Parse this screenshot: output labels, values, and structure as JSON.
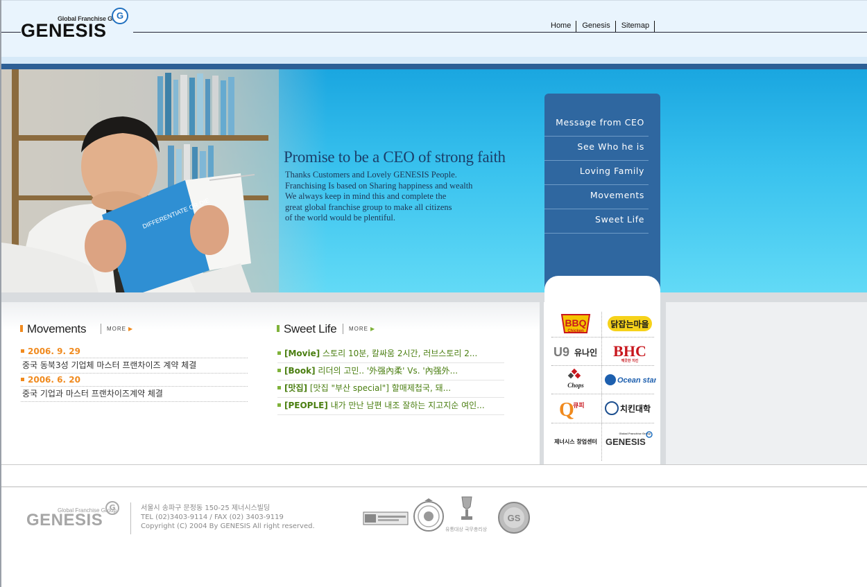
{
  "header": {
    "logo_tagline": "Global Franchise Group",
    "logo_wordmark": "GENESIS",
    "nav": [
      "Home",
      "Genesis",
      "Sitemap"
    ]
  },
  "hero": {
    "title": "Promise to be a CEO of strong faith",
    "lines": [
      "Thanks Customers and Lovely GENESIS People.",
      "Franchising Is based on Sharing happiness and wealth",
      "We always keep in mind this and complete the",
      "great global franchise group to make all citizens",
      "of the world would be plentiful."
    ],
    "book_cover_text": "DIFFERENTIATE OR DIE"
  },
  "sidemenu": [
    "Message from CEO",
    "See Who he is",
    "Loving Family",
    "Movements",
    "Sweet Life"
  ],
  "movements": {
    "title": "Movements",
    "more": "MORE",
    "items": [
      {
        "date": "2006. 9. 29",
        "text": "중국 동북3성 기업체 마스터 프랜차이즈 계약 체결"
      },
      {
        "date": "2006. 6. 20",
        "text": "중국 기업과 마스터 프랜차이즈계약 체결"
      }
    ]
  },
  "sweetlife": {
    "title": "Sweet Life",
    "more": "MORE",
    "items": [
      {
        "tag": "[Movie]",
        "text": " 스토리 10분, 칼싸움 2시간, 러브스토리 2..."
      },
      {
        "tag": "[Book]",
        "text": " 리더의 고민.. '外强內柔' Vs. '內强外..."
      },
      {
        "tag": "[맛집]",
        "text": " [맛집 \"부산 special\"] 할매제첩국, 돼..."
      },
      {
        "tag": "[PEOPLE]",
        "text": " 내가 만난 남편 내조 잘하는 지고지순 여인..."
      }
    ]
  },
  "brands": {
    "bbq": "BBQ",
    "bbq_sub": "Chicken",
    "dakmaeul": "닭잡는마을",
    "u9": "U9",
    "u9_kr": "유나인",
    "bhc": "BHC",
    "bhc_sub": "깨끗한 치킨",
    "chops": "Chops",
    "oceanstar": "Ocean star",
    "qp": "Q",
    "qp_kr": "큐피",
    "chicken_univ": "치킨대학",
    "startup": "제너시스 창업센터",
    "genesis": "GENESIS",
    "genesis_tag": "Global Franchise Group"
  },
  "footer": {
    "logo_tagline": "Global Franchise Group",
    "logo_wordmark": "GENESIS",
    "address": "서울시 송파구 문정동 150-25 제너시스빌딩",
    "tel": "TEL (02)3403-9114 / FAX (02) 3403-9119",
    "copyright": "Copyright (C) 2004 By GENESIS All right reserved.",
    "award_caption": "유통대상 국무총리상"
  },
  "colors": {
    "accent_orange": "#f08a1e",
    "accent_green": "#7fb23a",
    "menu_blue": "#2f67a0",
    "hero_cyan": "#39c2ee"
  }
}
